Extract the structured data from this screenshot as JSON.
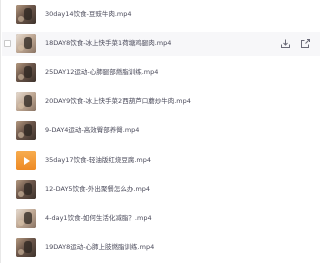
{
  "files": [
    {
      "name": "30day14饮食-豆豉牛肉.mp4",
      "thumb": "video-thumbnail"
    },
    {
      "name": "18DAY8饮食-冰上快手菜1荷塘鸡腿肉.mp4",
      "thumb": "video-thumbnail"
    },
    {
      "name": "25DAY12运动-心肺腿部燃脂训练.mp4",
      "thumb": "video-thumbnail"
    },
    {
      "name": "20DAY9饮食-冰上快手菜2西葫芦口蘑炒牛肉.mp4",
      "thumb": "video-thumbnail"
    },
    {
      "name": "9-DAY4运动-高效臀部养臀.mp4",
      "thumb": "video-thumbnail"
    },
    {
      "name": "35day17饮食-轻油版红烧豆腐.mp4",
      "thumb": "video-file-icon"
    },
    {
      "name": "12-DAY5饮食-外出聚餐怎么办.mp4",
      "thumb": "video-thumbnail"
    },
    {
      "name": "4-day1饮食-如何生活化减脂？.mp4",
      "thumb": "video-thumbnail"
    },
    {
      "name": "19DAY8运动-心肺上肢燃脂训练.mp4",
      "thumb": "video-thumbnail"
    }
  ],
  "hovered_row_actions": [
    {
      "icon": "download-icon"
    },
    {
      "icon": "share-icon"
    }
  ],
  "colors": {
    "text": "#4a4a5a",
    "hover_background": "#f7f7f9",
    "video_file_icon": "#f39a36"
  }
}
